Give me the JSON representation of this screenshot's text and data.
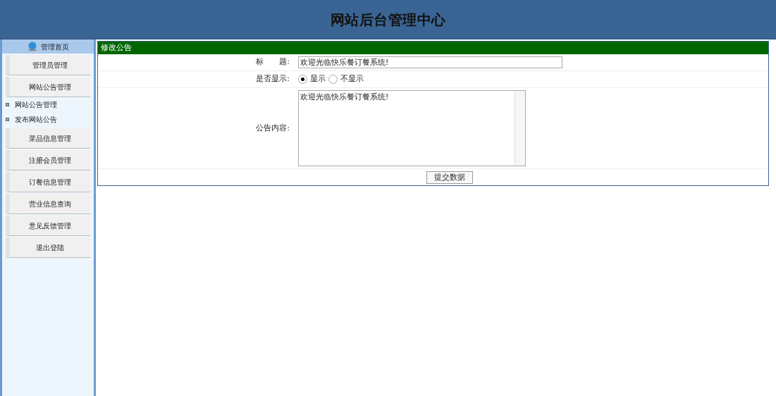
{
  "header": {
    "title": "网站后台管理中心"
  },
  "sidebar": {
    "home": "管理首页",
    "items": [
      {
        "kind": "button",
        "label": "管理员管理"
      },
      {
        "kind": "button",
        "label": "网站公告管理"
      },
      {
        "kind": "sub",
        "label": "网站公告管理"
      },
      {
        "kind": "sub",
        "label": "发布网站公告"
      },
      {
        "kind": "button",
        "label": "菜品信息管理"
      },
      {
        "kind": "button",
        "label": "注册会员管理"
      },
      {
        "kind": "button",
        "label": "订餐信息管理"
      },
      {
        "kind": "button",
        "label": "营业信息查询"
      },
      {
        "kind": "button",
        "label": "意见反馈管理"
      },
      {
        "kind": "button",
        "label": "退出登陆"
      }
    ]
  },
  "form": {
    "title": "修改公告",
    "title_field": {
      "label": "标　　题:",
      "value": "欢迎光临快乐餐订餐系统!"
    },
    "display": {
      "label": "是否显示:",
      "options": [
        {
          "label": "显示",
          "selected": true
        },
        {
          "label": "不显示",
          "selected": false
        }
      ]
    },
    "content": {
      "label": "公告内容:",
      "value": "欢迎光临快乐餐订餐系统!"
    },
    "submit": "提交数据"
  }
}
